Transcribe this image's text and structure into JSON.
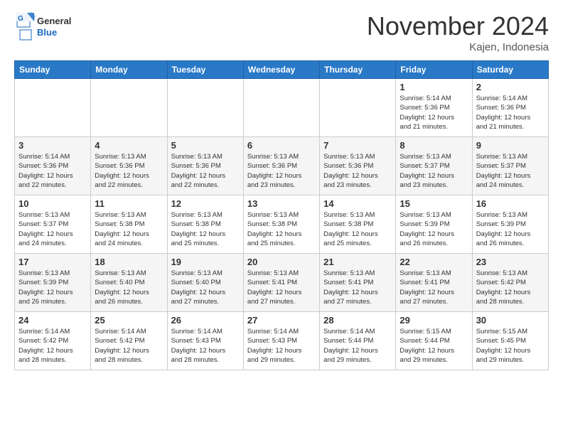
{
  "header": {
    "logo_general": "General",
    "logo_blue": "Blue",
    "month_title": "November 2024",
    "location": "Kajen, Indonesia"
  },
  "weekdays": [
    "Sunday",
    "Monday",
    "Tuesday",
    "Wednesday",
    "Thursday",
    "Friday",
    "Saturday"
  ],
  "weeks": [
    [
      {
        "day": "",
        "info": ""
      },
      {
        "day": "",
        "info": ""
      },
      {
        "day": "",
        "info": ""
      },
      {
        "day": "",
        "info": ""
      },
      {
        "day": "",
        "info": ""
      },
      {
        "day": "1",
        "info": "Sunrise: 5:14 AM\nSunset: 5:36 PM\nDaylight: 12 hours\nand 21 minutes."
      },
      {
        "day": "2",
        "info": "Sunrise: 5:14 AM\nSunset: 5:36 PM\nDaylight: 12 hours\nand 21 minutes."
      }
    ],
    [
      {
        "day": "3",
        "info": "Sunrise: 5:14 AM\nSunset: 5:36 PM\nDaylight: 12 hours\nand 22 minutes."
      },
      {
        "day": "4",
        "info": "Sunrise: 5:13 AM\nSunset: 5:36 PM\nDaylight: 12 hours\nand 22 minutes."
      },
      {
        "day": "5",
        "info": "Sunrise: 5:13 AM\nSunset: 5:36 PM\nDaylight: 12 hours\nand 22 minutes."
      },
      {
        "day": "6",
        "info": "Sunrise: 5:13 AM\nSunset: 5:36 PM\nDaylight: 12 hours\nand 23 minutes."
      },
      {
        "day": "7",
        "info": "Sunrise: 5:13 AM\nSunset: 5:36 PM\nDaylight: 12 hours\nand 23 minutes."
      },
      {
        "day": "8",
        "info": "Sunrise: 5:13 AM\nSunset: 5:37 PM\nDaylight: 12 hours\nand 23 minutes."
      },
      {
        "day": "9",
        "info": "Sunrise: 5:13 AM\nSunset: 5:37 PM\nDaylight: 12 hours\nand 24 minutes."
      }
    ],
    [
      {
        "day": "10",
        "info": "Sunrise: 5:13 AM\nSunset: 5:37 PM\nDaylight: 12 hours\nand 24 minutes."
      },
      {
        "day": "11",
        "info": "Sunrise: 5:13 AM\nSunset: 5:38 PM\nDaylight: 12 hours\nand 24 minutes."
      },
      {
        "day": "12",
        "info": "Sunrise: 5:13 AM\nSunset: 5:38 PM\nDaylight: 12 hours\nand 25 minutes."
      },
      {
        "day": "13",
        "info": "Sunrise: 5:13 AM\nSunset: 5:38 PM\nDaylight: 12 hours\nand 25 minutes."
      },
      {
        "day": "14",
        "info": "Sunrise: 5:13 AM\nSunset: 5:38 PM\nDaylight: 12 hours\nand 25 minutes."
      },
      {
        "day": "15",
        "info": "Sunrise: 5:13 AM\nSunset: 5:39 PM\nDaylight: 12 hours\nand 26 minutes."
      },
      {
        "day": "16",
        "info": "Sunrise: 5:13 AM\nSunset: 5:39 PM\nDaylight: 12 hours\nand 26 minutes."
      }
    ],
    [
      {
        "day": "17",
        "info": "Sunrise: 5:13 AM\nSunset: 5:39 PM\nDaylight: 12 hours\nand 26 minutes."
      },
      {
        "day": "18",
        "info": "Sunrise: 5:13 AM\nSunset: 5:40 PM\nDaylight: 12 hours\nand 26 minutes."
      },
      {
        "day": "19",
        "info": "Sunrise: 5:13 AM\nSunset: 5:40 PM\nDaylight: 12 hours\nand 27 minutes."
      },
      {
        "day": "20",
        "info": "Sunrise: 5:13 AM\nSunset: 5:41 PM\nDaylight: 12 hours\nand 27 minutes."
      },
      {
        "day": "21",
        "info": "Sunrise: 5:13 AM\nSunset: 5:41 PM\nDaylight: 12 hours\nand 27 minutes."
      },
      {
        "day": "22",
        "info": "Sunrise: 5:13 AM\nSunset: 5:41 PM\nDaylight: 12 hours\nand 27 minutes."
      },
      {
        "day": "23",
        "info": "Sunrise: 5:13 AM\nSunset: 5:42 PM\nDaylight: 12 hours\nand 28 minutes."
      }
    ],
    [
      {
        "day": "24",
        "info": "Sunrise: 5:14 AM\nSunset: 5:42 PM\nDaylight: 12 hours\nand 28 minutes."
      },
      {
        "day": "25",
        "info": "Sunrise: 5:14 AM\nSunset: 5:42 PM\nDaylight: 12 hours\nand 28 minutes."
      },
      {
        "day": "26",
        "info": "Sunrise: 5:14 AM\nSunset: 5:43 PM\nDaylight: 12 hours\nand 28 minutes."
      },
      {
        "day": "27",
        "info": "Sunrise: 5:14 AM\nSunset: 5:43 PM\nDaylight: 12 hours\nand 29 minutes."
      },
      {
        "day": "28",
        "info": "Sunrise: 5:14 AM\nSunset: 5:44 PM\nDaylight: 12 hours\nand 29 minutes."
      },
      {
        "day": "29",
        "info": "Sunrise: 5:15 AM\nSunset: 5:44 PM\nDaylight: 12 hours\nand 29 minutes."
      },
      {
        "day": "30",
        "info": "Sunrise: 5:15 AM\nSunset: 5:45 PM\nDaylight: 12 hours\nand 29 minutes."
      }
    ]
  ]
}
